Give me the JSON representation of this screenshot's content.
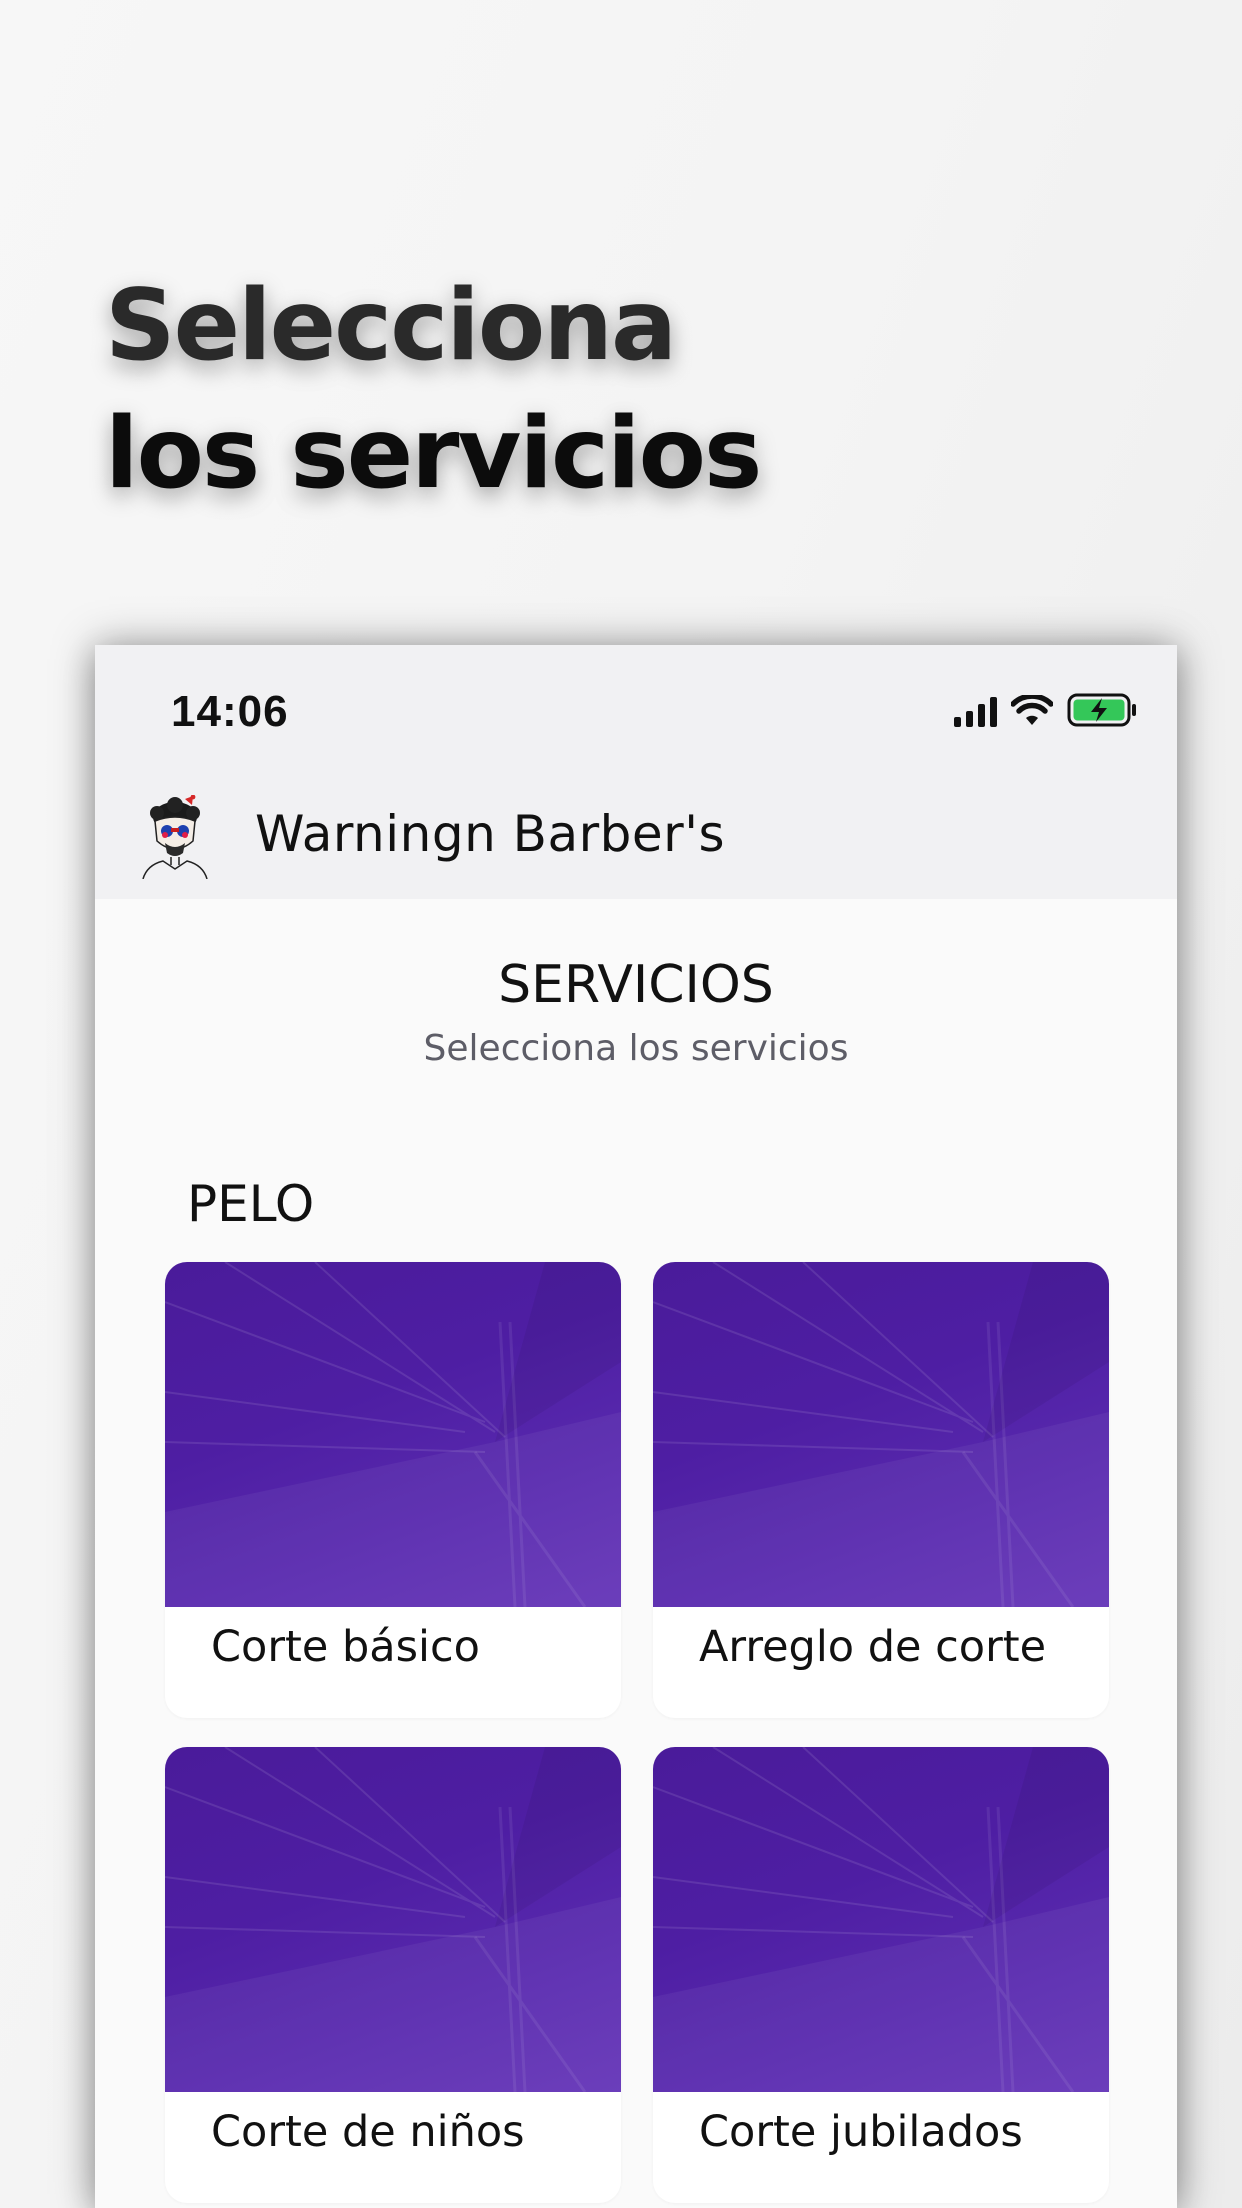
{
  "promo": {
    "headline_line1": "Selecciona",
    "headline_line2": "los servicios"
  },
  "status_bar": {
    "time": "14:06",
    "icons": [
      "signal-icon",
      "wifi-icon",
      "battery-charging-icon"
    ],
    "battery_color": "#34c759"
  },
  "app_header": {
    "title": "Warningn Barber's",
    "avatar": "barber-avatar-icon"
  },
  "main": {
    "title": "SERVICIOS",
    "subtitle": "Selecciona los servicios"
  },
  "categories": [
    {
      "label": "PELO",
      "services": [
        {
          "label": "Corte básico"
        },
        {
          "label": "Arreglo de corte"
        },
        {
          "label": "Corte de niños"
        },
        {
          "label": "Corte jubilados"
        }
      ]
    }
  ],
  "colors": {
    "card_image": "#4e1ea3",
    "card_background": "#ffffff",
    "page_background": "#fafafa"
  }
}
